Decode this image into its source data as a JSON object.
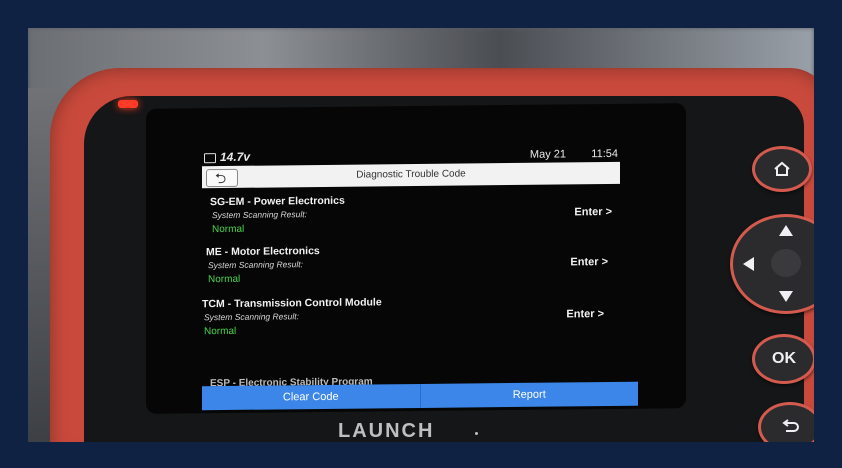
{
  "status": {
    "num": "14.7v",
    "date": "May 21",
    "time": "11:54"
  },
  "header": {
    "back_glyph": "⮌",
    "title": "Diagnostic Trouble Code"
  },
  "rows": [
    {
      "name": "SG-EM - Power Electronics",
      "label": "System Scanning Result:",
      "status": "Normal",
      "enter": "Enter >"
    },
    {
      "name": "ME - Motor Electronics",
      "label": "System Scanning Result:",
      "status": "Normal",
      "enter": "Enter >"
    },
    {
      "name": "TCM - Transmission Control Module",
      "label": "System Scanning Result:",
      "status": "Normal",
      "enter": "Enter >"
    }
  ],
  "partial_row": "ESP - Electronic Stability Program",
  "buttons": {
    "clear": "Clear Code",
    "report": "Report"
  },
  "brand": "LAUNCH",
  "hardware": {
    "ok": "OK"
  },
  "colors": {
    "device": "#c94a3c",
    "accent_button": "#3b86e8",
    "status_green": "#4ad64a",
    "led": "#ff3a26"
  }
}
